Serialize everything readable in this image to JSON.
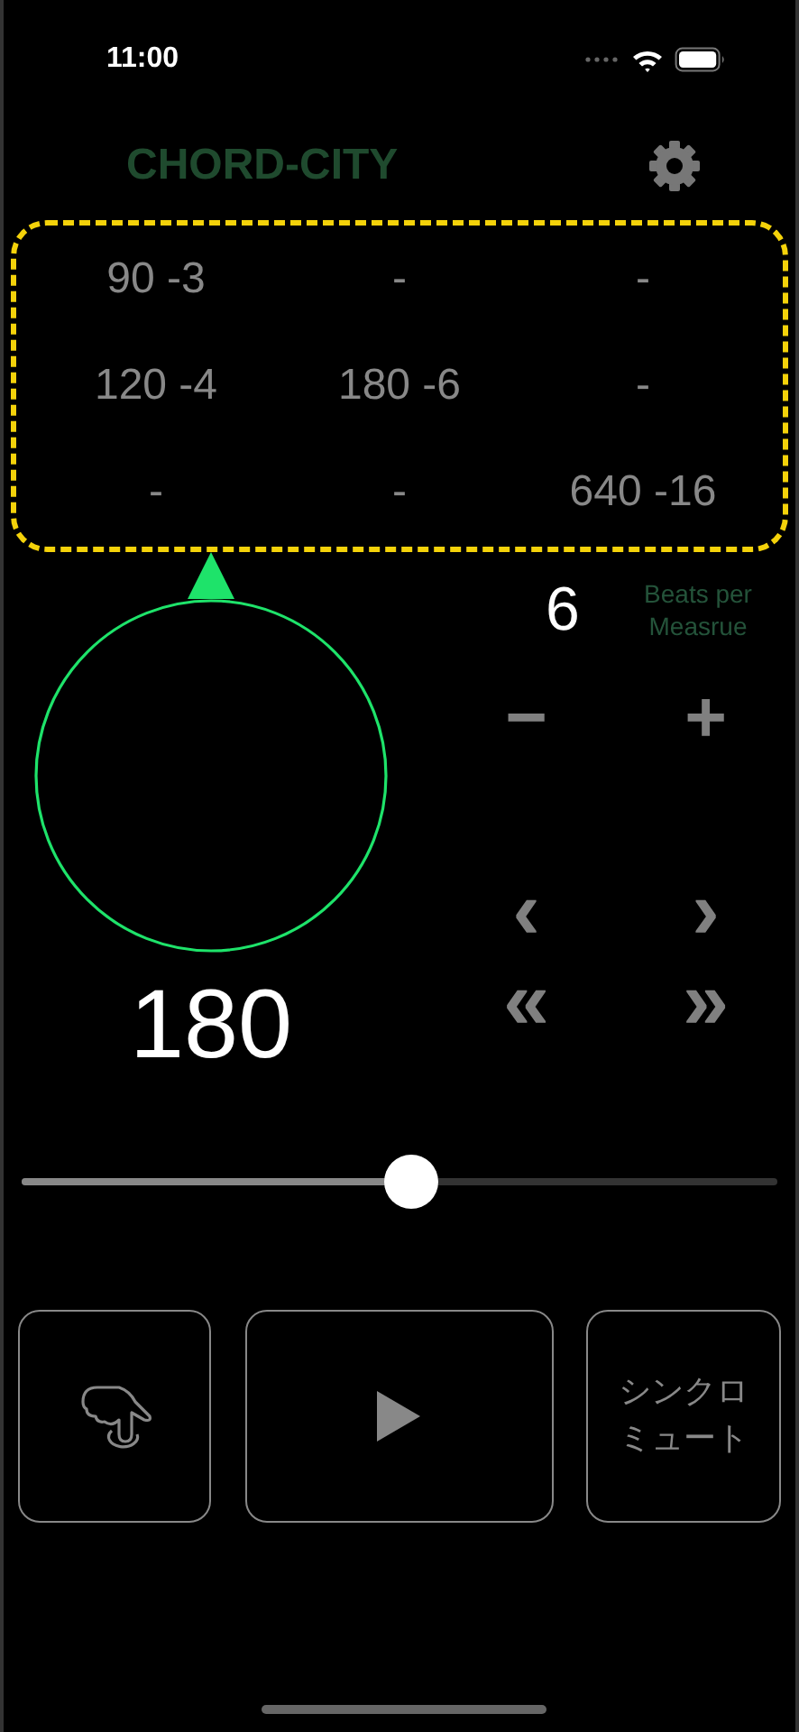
{
  "status_bar": {
    "time": "11:00"
  },
  "header": {
    "title": "CHORD-CITY"
  },
  "presets": [
    [
      "90 -3",
      "-",
      "-"
    ],
    [
      "120 -4",
      "180 -6",
      "-"
    ],
    [
      "-",
      "-",
      "640 -16"
    ]
  ],
  "beats": {
    "value": "6",
    "label": "Beats per Measrue",
    "minus": "−",
    "plus": "+"
  },
  "tempo": {
    "value": "180"
  },
  "nav": {
    "prev": "‹",
    "next": "›",
    "prev_fast": "«",
    "next_fast": "»"
  },
  "slider": {
    "level": 0.516
  },
  "buttons": {
    "mute_lines": [
      "シンクロ",
      "ミュート"
    ]
  }
}
